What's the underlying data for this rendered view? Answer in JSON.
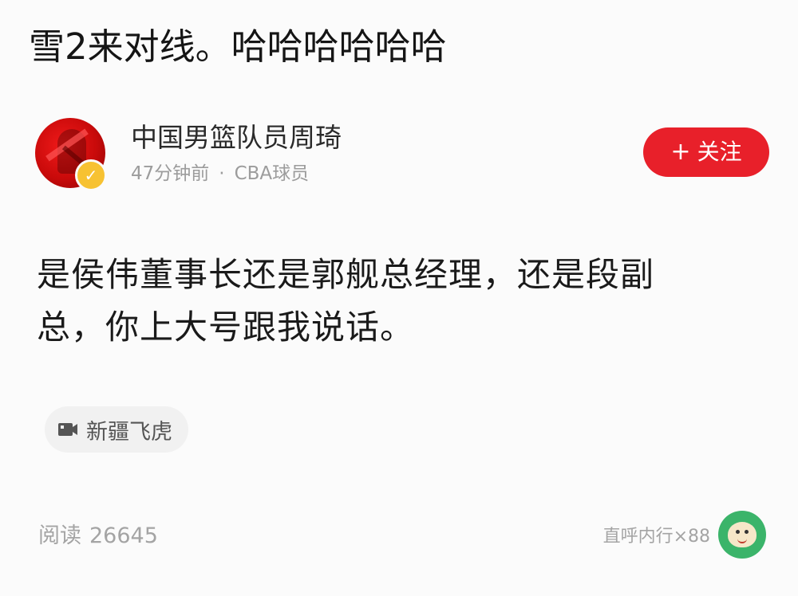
{
  "top_comment": "雪2来对线。哈哈哈哈哈哈",
  "author": {
    "name": "中国男篮队员周琦",
    "time": "47分钟前",
    "separator": "·",
    "title": "CBA球员",
    "verified_mark": "✓"
  },
  "follow_button": {
    "plus": "+",
    "label": "关注"
  },
  "post": {
    "line1": "是侯伟董事长还是郭舰总经理，还是段副",
    "line2": "总，你上大号跟我说话。"
  },
  "tag": {
    "icon": "video-tag-icon",
    "label": "新疆飞虎"
  },
  "footer": {
    "read_label": "阅读",
    "read_count": "26645",
    "reward_text": "直呼内行×88",
    "reward_icon": "reward-badge-icon"
  },
  "colors": {
    "accent_red": "#e8202a",
    "reward_green": "#3bb46a",
    "verified_gold": "#f7c232",
    "text_gray": "#a4a4a4"
  }
}
